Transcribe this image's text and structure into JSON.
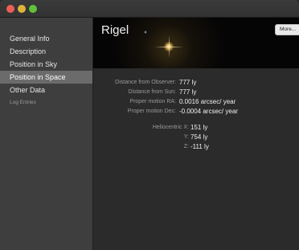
{
  "window": {
    "controls": [
      "close",
      "minimize",
      "zoom"
    ]
  },
  "sidebar": {
    "items": [
      {
        "label": "General Info"
      },
      {
        "label": "Description"
      },
      {
        "label": "Position in Sky"
      },
      {
        "label": "Position in Space",
        "selected": true
      },
      {
        "label": "Other Data"
      },
      {
        "label": "Log Entries"
      }
    ]
  },
  "header": {
    "title": "Rigel",
    "more_label": "More..."
  },
  "details": {
    "distance_observer": {
      "label": "Distance from Observer:",
      "value": "777 ly"
    },
    "distance_sun": {
      "label": "Distance from Sun:",
      "value": "777 ly"
    },
    "pm_ra": {
      "label": "Proper motion RA:",
      "value": "0.0016 arcsec/ year"
    },
    "pm_dec": {
      "label": "Proper motion Dec:",
      "value": "-0.0004 arcsec/ year"
    },
    "helio_x": {
      "label": "Heliocentric X:",
      "value": "151 ly"
    },
    "helio_y": {
      "label": "Y:",
      "value": "754 ly"
    },
    "helio_z": {
      "label": "Z:",
      "value": "-111 ly"
    }
  },
  "colors": {
    "sidebar_bg": "#3e3e3e",
    "selected_bg": "#6b6b6b",
    "content_bg": "#2b2b2b"
  }
}
